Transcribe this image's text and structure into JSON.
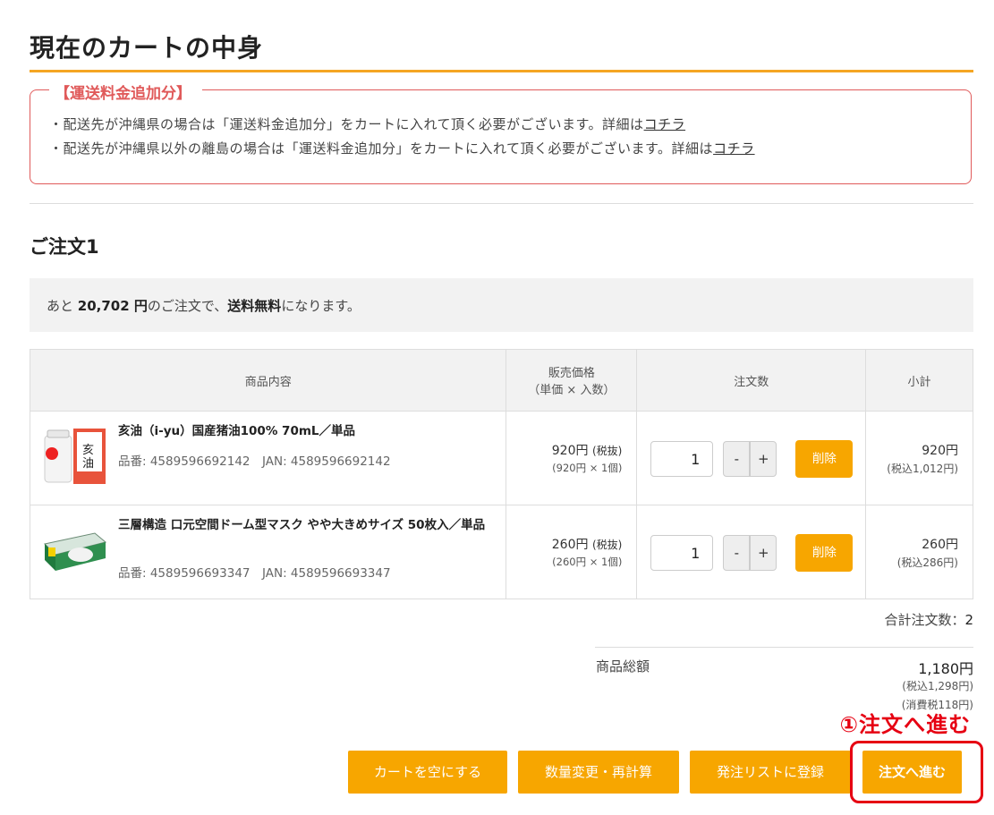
{
  "page": {
    "title": "現在のカートの中身"
  },
  "notice": {
    "heading": "【運送料金追加分】",
    "line1_text": "・配送先が沖縄県の場合は「運送料金追加分」をカートに入れて頂く必要がございます。詳細は",
    "line1_link": "コチラ",
    "line2_text": "・配送先が沖縄県以外の離島の場合は「運送料金追加分」をカートに入れて頂く必要がございます。詳細は",
    "line2_link": "コチラ"
  },
  "order": {
    "title": "ご注文1",
    "shipping_prefix": "あと ",
    "shipping_amount": "20,702 円",
    "shipping_middle": "のご注文で、",
    "shipping_bold": "送料無料",
    "shipping_suffix": "になります。"
  },
  "table": {
    "headers": {
      "product": "商品内容",
      "price_line1": "販売価格",
      "price_line2": "（単価 × 入数）",
      "qty": "注文数",
      "subtotal": "小計"
    }
  },
  "items": [
    {
      "name": "亥油（i-yu）国産猪油100% 70mL／単品",
      "code": "品番: 4589596692142　JAN: 4589596692142",
      "price": "920円",
      "price_tax_note": "(税抜)",
      "price_detail": "(920円 × 1個)",
      "qty": "1",
      "subtotal": "920円",
      "subtotal_tax": "(税込1,012円)"
    },
    {
      "name": "三層構造 口元空間ドーム型マスク やや大きめサイズ 50枚入／単品",
      "code": "品番: 4589596693347　JAN: 4589596693347",
      "price": "260円",
      "price_tax_note": "(税抜)",
      "price_detail": "(260円 × 1個)",
      "qty": "1",
      "subtotal": "260円",
      "subtotal_tax": "(税込286円)"
    }
  ],
  "controls": {
    "minus": "-",
    "plus": "+",
    "delete": "削除"
  },
  "summary": {
    "total_count_label": "合計注文数：",
    "total_count": "2",
    "goods_total_label": "商品総額",
    "goods_total": "1,180円",
    "tax_included": "(税込1,298円)",
    "consumption_tax": "(消費税118円)"
  },
  "annotation": "①注文へ進む",
  "buttons": {
    "empty_cart": "カートを空にする",
    "recalc": "数量変更・再計算",
    "order_list": "発注リストに登録",
    "proceed": "注文へ進む"
  },
  "colors": {
    "accent": "#f7a600",
    "rule": "#f5a623",
    "notice": "#e05a5a",
    "highlight": "#e60012"
  }
}
